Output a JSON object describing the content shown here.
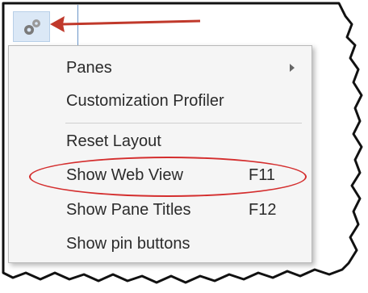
{
  "settings_button": {
    "icon": "gears-icon"
  },
  "menu": {
    "items": [
      {
        "label": "Panes",
        "shortcut": "",
        "has_submenu": true
      },
      {
        "label": "Customization Profiler",
        "shortcut": "",
        "has_submenu": false
      },
      {
        "label": "Reset Layout",
        "shortcut": "",
        "has_submenu": false
      },
      {
        "label": "Show Web View",
        "shortcut": "F11",
        "has_submenu": false,
        "highlighted": true
      },
      {
        "label": "Show Pane Titles",
        "shortcut": "F12",
        "has_submenu": false
      },
      {
        "label": "Show pin buttons",
        "shortcut": "",
        "has_submenu": false
      }
    ]
  },
  "colors": {
    "annotation_red": "#d42e2e",
    "arrow_red": "#c0392b",
    "menu_background": "#f5f5f5",
    "button_highlight": "#dbe8f6"
  }
}
